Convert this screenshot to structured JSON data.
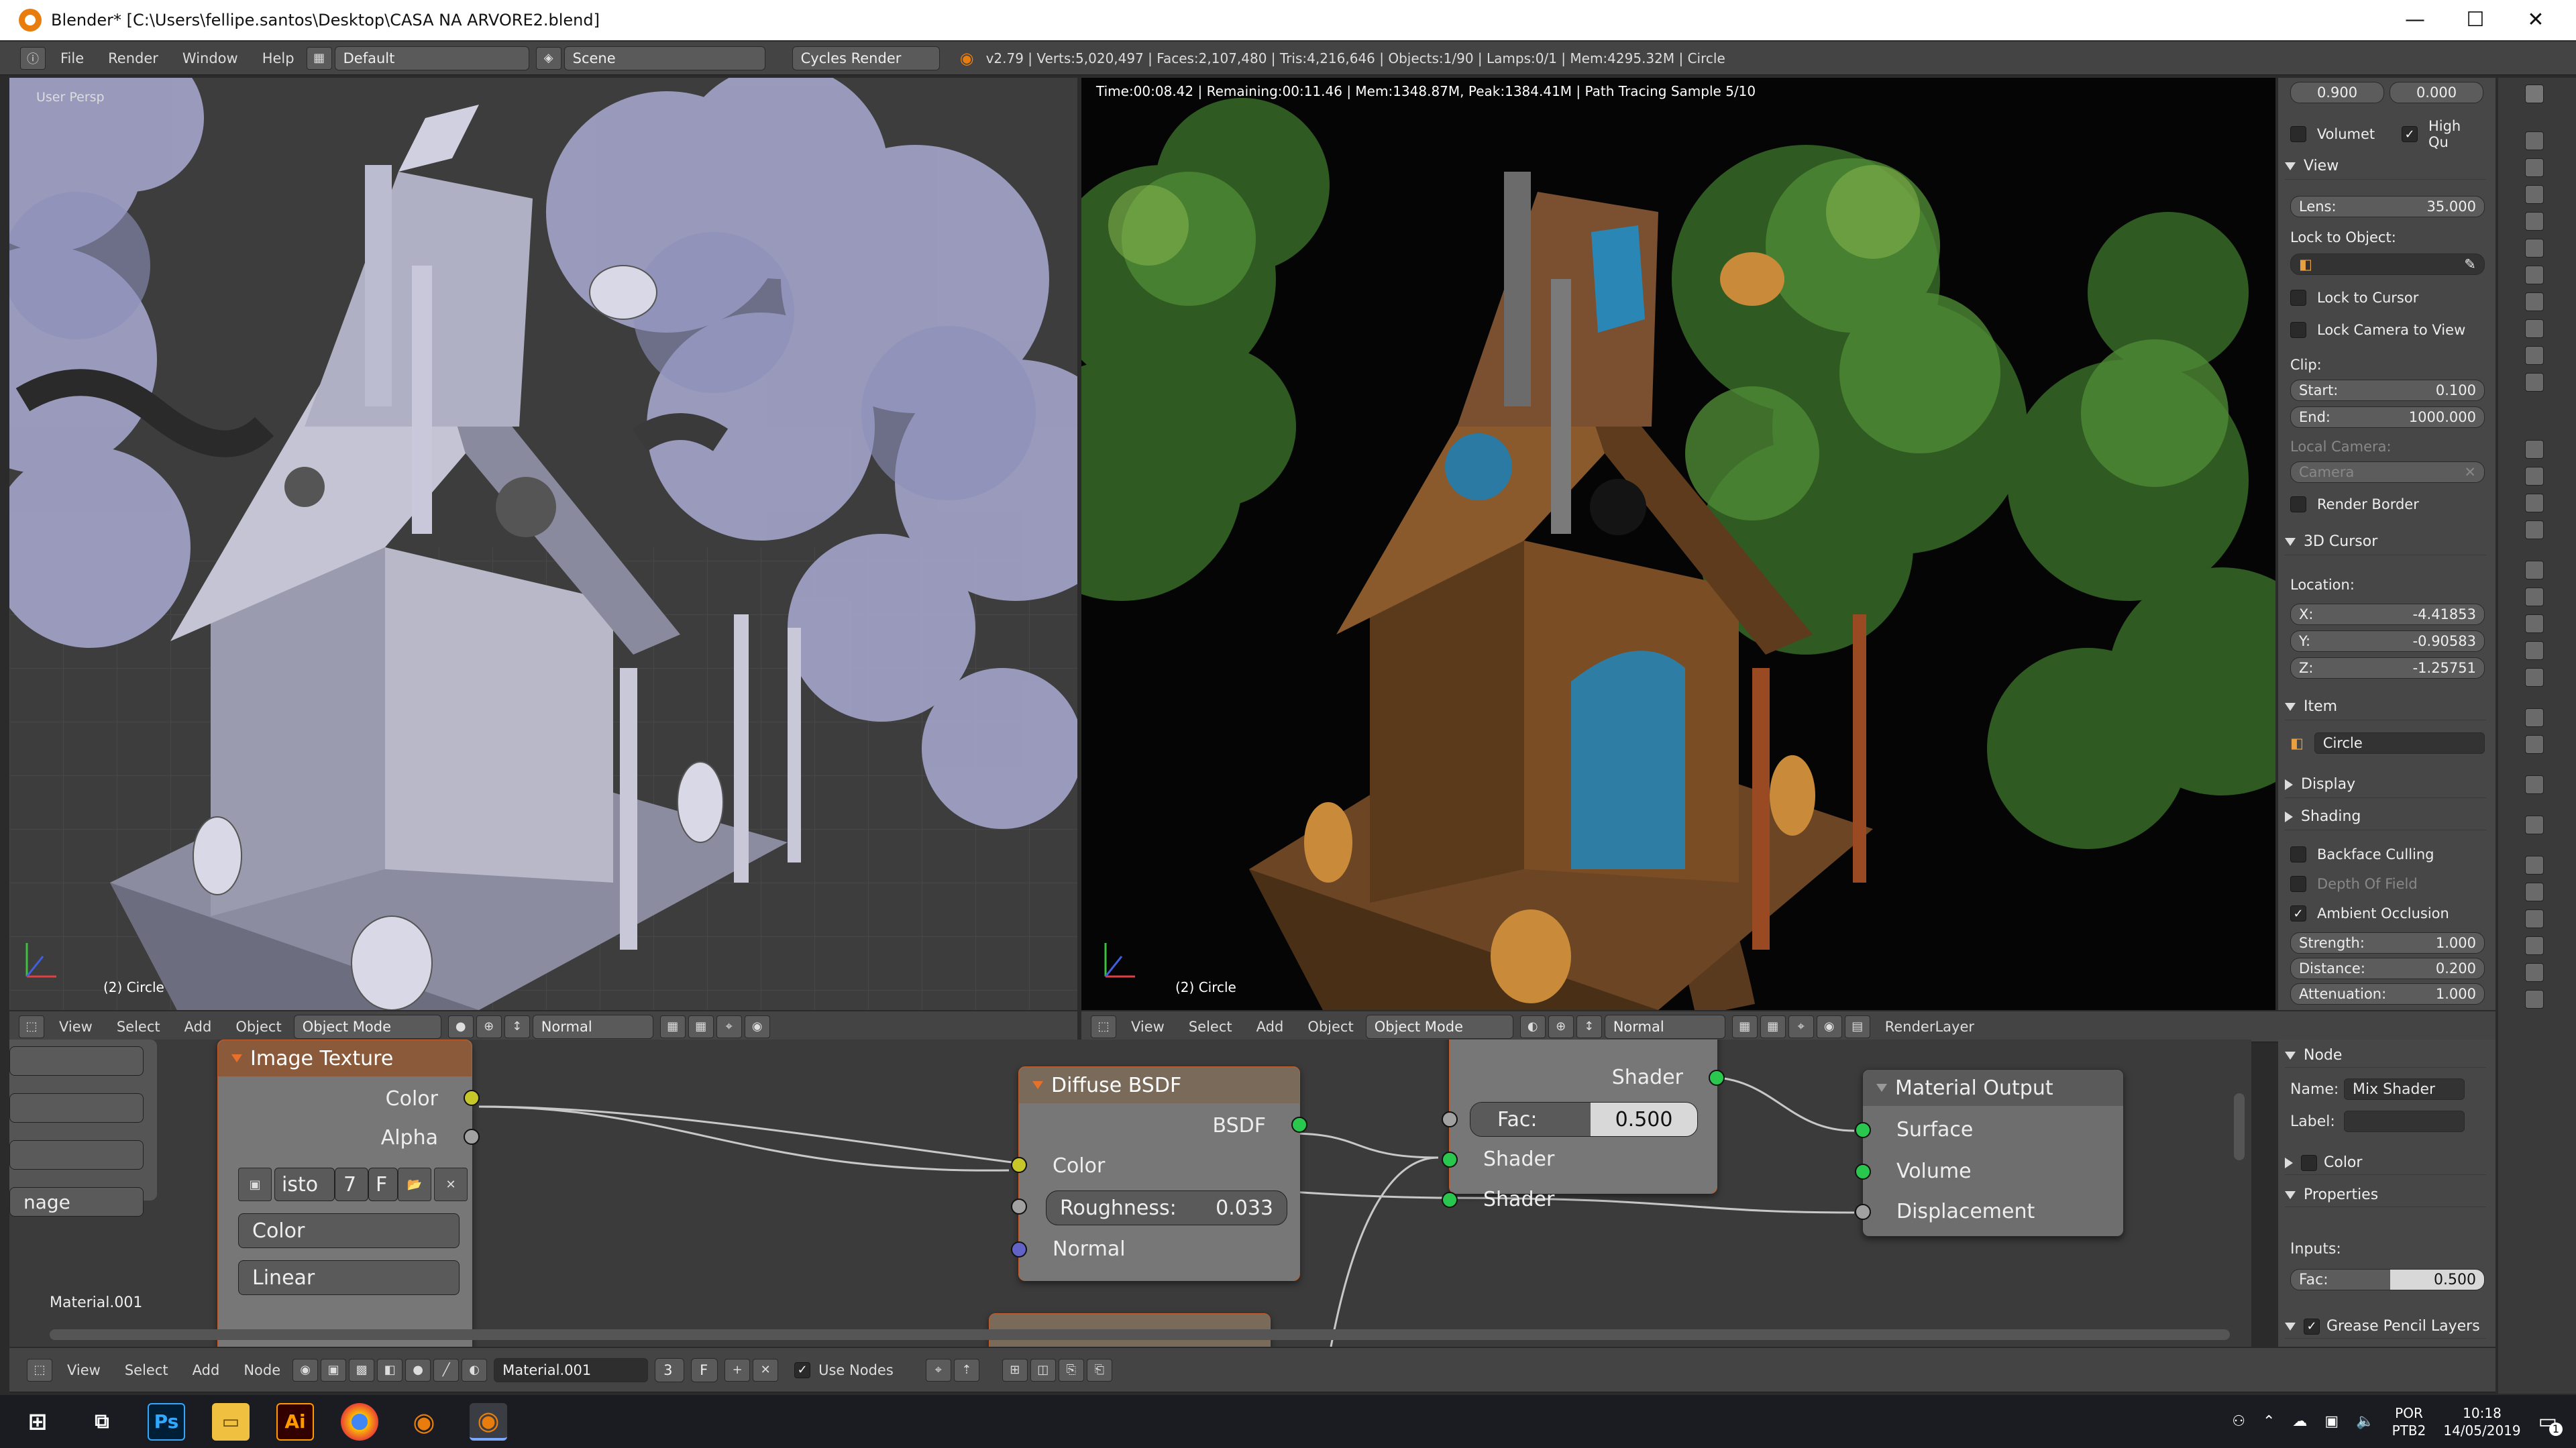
{
  "window": {
    "title": "Blender* [C:\\Users\\fellipe.santos\\Desktop\\CASA NA ARVORE2.blend]",
    "minimize": "—",
    "maximize": "☐",
    "close": "✕"
  },
  "menubar": {
    "info_icon": "info-icon",
    "menus": [
      "File",
      "Render",
      "Window",
      "Help"
    ],
    "layout": "Default",
    "scene": "Scene",
    "engine": "Cycles Render",
    "stats": "v2.79 | Verts:5,020,497 | Faces:2,107,480 | Tris:4,216,646 | Objects:1/90 | Lamps:0/1 | Mem:4295.32M | Circle"
  },
  "left_viewport": {
    "label": "User Persp",
    "object": "(2) Circle"
  },
  "right_viewport": {
    "status": "Time:00:08.42 | Remaining:00:11.46 | Mem:1348.87M, Peak:1384.41M | Path Tracing Sample 5/10",
    "object": "(2) Circle"
  },
  "n_panel": {
    "top_values": [
      "0.900",
      "0.000"
    ],
    "volumetric": "Volumet",
    "high_quality": "High Qu",
    "view_header": "View",
    "lens_label": "Lens:",
    "lens_value": "35.000",
    "lock_to_object": "Lock to Object:",
    "lock_to_cursor": "Lock to Cursor",
    "lock_camera": "Lock Camera to View",
    "clip_label": "Clip:",
    "start_label": "Start:",
    "start_value": "0.100",
    "end_label": "End:",
    "end_value": "1000.000",
    "local_camera": "Local Camera:",
    "camera": "Camera",
    "render_border": "Render Border",
    "cursor_header": "3D Cursor",
    "location": "Location:",
    "x_label": "X:",
    "x_value": "-4.41853",
    "y_label": "Y:",
    "y_value": "-0.90583",
    "z_label": "Z:",
    "z_value": "-1.25751",
    "item_header": "Item",
    "item_name": "Circle",
    "display_header": "Display",
    "shading_header": "Shading",
    "backface": "Backface Culling",
    "dof": "Depth Of Field",
    "ao": "Ambient Occlusion",
    "strength_label": "Strength:",
    "strength_value": "1.000",
    "distance_label": "Distance:",
    "distance_value": "0.200",
    "attenuation_label": "Attenuation:",
    "attenuation_value": "1.000"
  },
  "left_header": {
    "menus": [
      "View",
      "Select",
      "Add",
      "Object"
    ],
    "mode": "Object Mode",
    "orientation": "Normal"
  },
  "right_header": {
    "menus": [
      "View",
      "Select",
      "Add",
      "Object"
    ],
    "mode": "Object Mode",
    "orientation": "Normal",
    "render_layer": "RenderLayer"
  },
  "node_editor": {
    "left_partial_fields": [
      "",
      "",
      "",
      "nage"
    ],
    "material_label": "Material.001",
    "image_texture": {
      "title": "Image Texture",
      "out_color": "Color",
      "out_alpha": "Alpha",
      "image_name": "isto",
      "users": "7",
      "fake": "F",
      "color_space": "Color",
      "interp": "Linear"
    },
    "diffuse": {
      "title": "Diffuse BSDF",
      "out": "BSDF",
      "in_color": "Color",
      "roughness_label": "Roughness:",
      "roughness_value": "0.033",
      "in_normal": "Normal"
    },
    "mix": {
      "out": "Shader",
      "fac_label": "Fac:",
      "fac_value": "0.500",
      "in1": "Shader",
      "in2": "Shader"
    },
    "output": {
      "title": "Material Output",
      "surface": "Surface",
      "volume": "Volume",
      "displacement": "Displacement"
    }
  },
  "node_panel": {
    "header": "Node",
    "name_label": "Name:",
    "name_value": "Mix Shader",
    "label_label": "Label:",
    "color": "Color",
    "properties": "Properties",
    "inputs": "Inputs:",
    "fac_label": "Fac:",
    "fac_value": "0.500",
    "grease": "Grease Pencil Layers"
  },
  "node_header": {
    "menus": [
      "View",
      "Select",
      "Add",
      "Node"
    ],
    "material": "Material.001",
    "users": "3",
    "fake": "F",
    "use_nodes": "Use Nodes"
  },
  "taskbar": {
    "lang": "POR",
    "lang2": "PTB2",
    "time": "10:18",
    "date": "14/05/2019",
    "notif": "1"
  },
  "colors": {
    "socket_yellow": "#c7c729",
    "socket_green": "#29c74e",
    "socket_grey": "#a1a1a1",
    "socket_blue": "#6363c7",
    "node_header_orange": "#c25d2b"
  }
}
